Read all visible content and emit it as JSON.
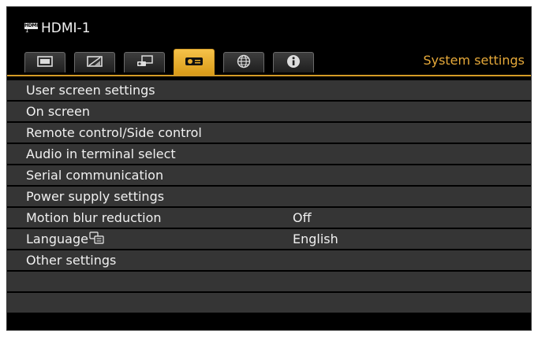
{
  "source": {
    "icon": "hdmi-icon",
    "icon_text": "HDMI",
    "icon_sub": "1",
    "label": "HDMI-1"
  },
  "tabs": [
    {
      "icon": "screen-icon",
      "active": false
    },
    {
      "icon": "image-adjust-icon",
      "active": false
    },
    {
      "icon": "installation-icon",
      "active": false
    },
    {
      "icon": "projector-icon",
      "active": true
    },
    {
      "icon": "globe-icon",
      "active": false
    },
    {
      "icon": "info-icon",
      "active": false
    }
  ],
  "section_title": "System settings",
  "menu": [
    {
      "label": "User screen settings",
      "value": ""
    },
    {
      "label": "On screen",
      "value": ""
    },
    {
      "label": "Remote control/Side control",
      "value": ""
    },
    {
      "label": "Audio in terminal select",
      "value": ""
    },
    {
      "label": "Serial communication",
      "value": ""
    },
    {
      "label": "Power supply settings",
      "value": ""
    },
    {
      "label": "Motion blur reduction",
      "value": "Off"
    },
    {
      "label": "Language",
      "value": "English"
    },
    {
      "label": "Other settings",
      "value": ""
    },
    {
      "label": "",
      "value": ""
    },
    {
      "label": "",
      "value": ""
    }
  ],
  "colors": {
    "accent": "#e6a93a",
    "active_tab": "#e8ac2c",
    "row_bg": "#353535",
    "text": "#f0f0f0"
  }
}
